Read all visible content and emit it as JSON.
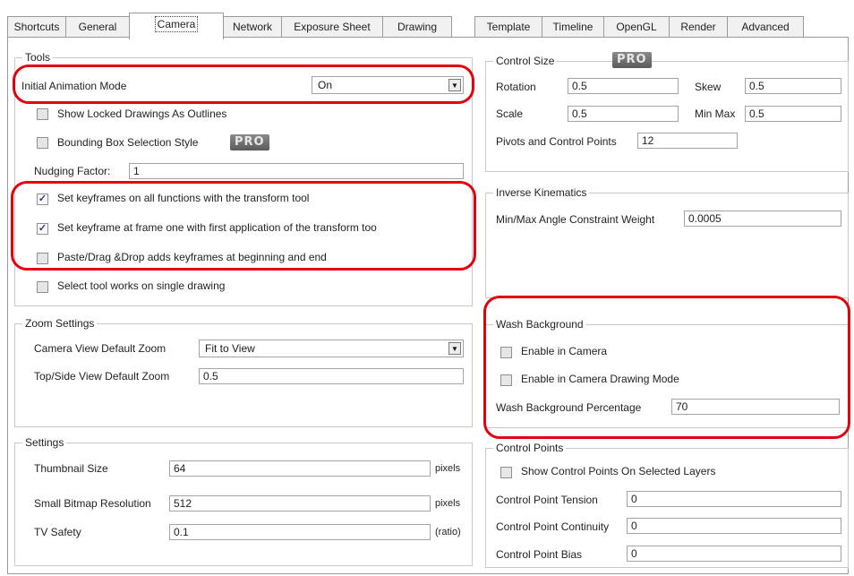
{
  "tabs": [
    "Shortcuts",
    "General",
    "Camera",
    "Network",
    "Exposure Sheet",
    "Drawing",
    "Template",
    "Timeline",
    "OpenGL",
    "Render",
    "Advanced"
  ],
  "tools": {
    "title": "Tools",
    "initial_animation_mode_label": "Initial Animation Mode",
    "initial_animation_mode_value": "On",
    "show_locked_label": "Show Locked Drawings As Outlines",
    "bounding_box_label": "Bounding Box Selection Style",
    "pro_badge": "PRO",
    "nudging_label": "Nudging Factor:",
    "nudging_value": "1",
    "set_keyframes_all_label": "Set keyframes on all functions with the transform tool",
    "set_keyframe_frame_one_label": "Set keyframe at frame one with first application of the transform too",
    "paste_drag_label": "Paste/Drag &Drop adds keyframes at beginning and end",
    "select_tool_label": "Select tool works on single drawing",
    "check": "✓"
  },
  "zoom": {
    "title": "Zoom Settings",
    "camera_view_label": "Camera View Default Zoom",
    "camera_view_value": "Fit to View",
    "top_side_label": "Top/Side View Default Zoom",
    "top_side_value": "0.5"
  },
  "settings": {
    "title": "Settings",
    "thumbnail_label": "Thumbnail Size",
    "thumbnail_value": "64",
    "thumbnail_unit": "pixels",
    "bitmap_label": "Small Bitmap Resolution",
    "bitmap_value": "512",
    "bitmap_unit": "pixels",
    "tv_label": "TV Safety",
    "tv_value": "0.1",
    "tv_unit": "(ratio)"
  },
  "control_size": {
    "title": "Control Size",
    "pro_badge": "PRO",
    "rotation_label": "Rotation",
    "rotation_value": "0.5",
    "skew_label": "Skew",
    "skew_value": "0.5",
    "scale_label": "Scale",
    "scale_value": "0.5",
    "minmax_label": "Min Max",
    "minmax_value": "0.5",
    "pivots_label": "Pivots and Control Points",
    "pivots_value": "12"
  },
  "ik": {
    "title": "Inverse Kinematics",
    "weight_label": "Min/Max Angle Constraint Weight",
    "weight_value": "0.0005"
  },
  "wash": {
    "title": "Wash Background",
    "enable_camera_label": "Enable in Camera",
    "enable_drawing_label": "Enable in Camera Drawing Mode",
    "percentage_label": "Wash Background Percentage",
    "percentage_value": "70"
  },
  "control_points": {
    "title": "Control Points",
    "show_label": "Show Control Points On Selected Layers",
    "tension_label": "Control Point Tension",
    "tension_value": "0",
    "continuity_label": "Control Point Continuity",
    "continuity_value": "0",
    "bias_label": "Control Point Bias",
    "bias_value": "0"
  },
  "colors": {
    "highlight": "#e3000f",
    "check": "#2a3a8a",
    "border": "#9a9a9a"
  }
}
